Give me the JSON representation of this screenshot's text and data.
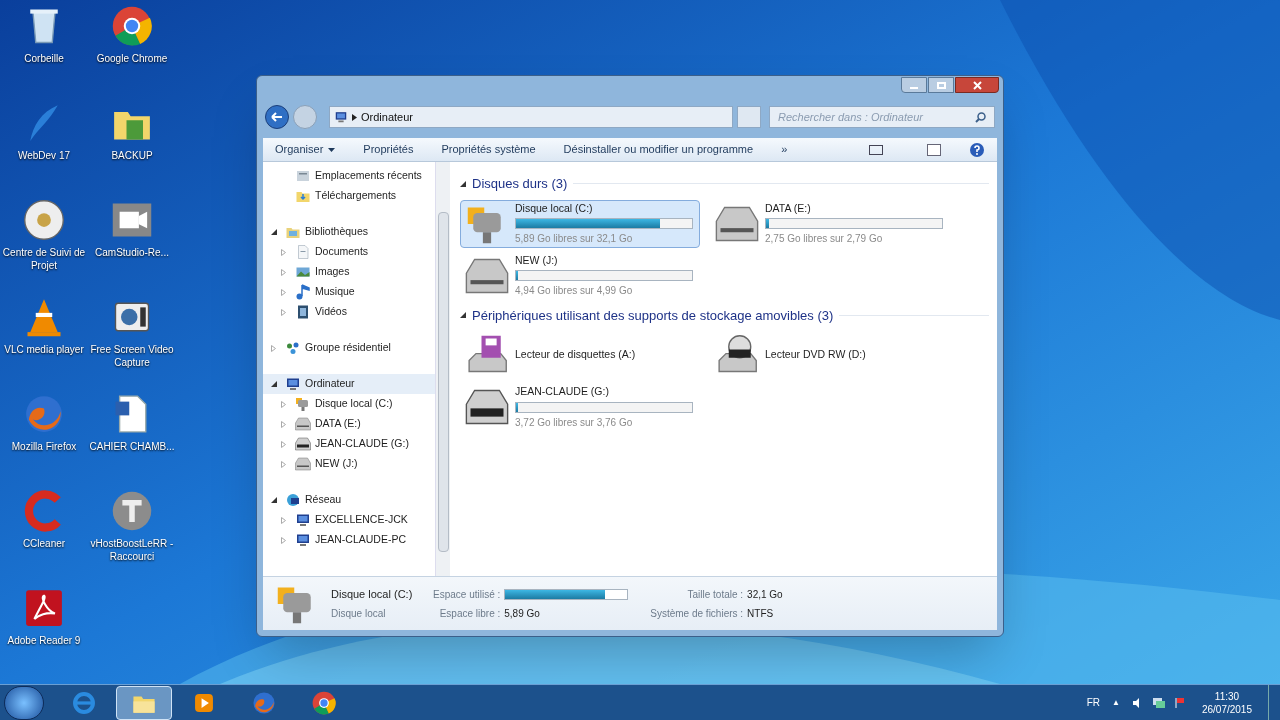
{
  "desktop_icons": [
    {
      "label": "Corbeille",
      "kind": "recycle"
    },
    {
      "label": "Google Chrome",
      "kind": "chrome"
    },
    {
      "label": "WebDev 17",
      "kind": "feather"
    },
    {
      "label": "BACKUP",
      "kind": "folder"
    },
    {
      "label": "Centre de Suivi de Projet",
      "kind": "disc"
    },
    {
      "label": "CamStudio-Re...",
      "kind": "camera"
    },
    {
      "label": "VLC media player",
      "kind": "cone"
    },
    {
      "label": "Free Screen Video Capture",
      "kind": "photo"
    },
    {
      "label": "Mozilla Firefox",
      "kind": "firefox"
    },
    {
      "label": "CAHIER CHAMB...",
      "kind": "document"
    },
    {
      "label": "CCleaner",
      "kind": "cleaner"
    },
    {
      "label": "vHostBoostLeRR - Raccourci",
      "kind": "letter"
    },
    {
      "label": "Adobe Reader 9",
      "kind": "pdf"
    }
  ],
  "window": {
    "address": {
      "crumb": "Ordinateur"
    },
    "search": {
      "placeholder": "Rechercher dans : Ordinateur"
    },
    "toolbar": [
      {
        "label": "Organiser",
        "kind": "menu"
      },
      {
        "label": "Propriétés",
        "kind": "plain"
      },
      {
        "label": "Propriétés système",
        "kind": "plain"
      },
      {
        "label": "Désinstaller ou modifier un programme",
        "kind": "plain"
      },
      {
        "label": "»",
        "kind": "plain"
      }
    ],
    "nav_tree": [
      {
        "label": "Emplacements récents",
        "kind": "recent",
        "expandable": false,
        "selected": false
      },
      {
        "label": "Téléchargements",
        "kind": "download",
        "expandable": false,
        "selected": false
      },
      {
        "label": "Bibliothèques",
        "kind": "library",
        "expandable": true,
        "expanded": true,
        "selected": false,
        "children": [
          {
            "label": "Documents",
            "kind": "docs",
            "expandable": true,
            "expanded": false,
            "selected": false
          },
          {
            "label": "Images",
            "kind": "images",
            "expandable": true,
            "expanded": false,
            "selected": false
          },
          {
            "label": "Musique",
            "kind": "music",
            "expandable": true,
            "expanded": false,
            "selected": false
          },
          {
            "label": "Vidéos",
            "kind": "video",
            "expandable": true,
            "expanded": false,
            "selected": false
          }
        ]
      },
      {
        "label": "Groupe résidentiel",
        "kind": "homegroup",
        "expandable": true,
        "expanded": false,
        "selected": false
      },
      {
        "label": "Ordinateur",
        "kind": "computer",
        "expandable": true,
        "expanded": true,
        "selected": true,
        "children": [
          {
            "label": "Disque local (C:)",
            "kind": "sysdrive",
            "expandable": true,
            "expanded": false,
            "selected": false
          },
          {
            "label": "DATA (E:)",
            "kind": "drive",
            "expandable": true,
            "expanded": false,
            "selected": false
          },
          {
            "label": "JEAN-CLAUDE (G:)",
            "kind": "usb",
            "expandable": true,
            "expanded": false,
            "selected": false
          },
          {
            "label": "NEW (J:)",
            "kind": "drive",
            "expandable": true,
            "expanded": false,
            "selected": false
          }
        ]
      },
      {
        "label": "Réseau",
        "kind": "network",
        "expandable": true,
        "expanded": true,
        "selected": false,
        "children": [
          {
            "label": "EXCELLENCE-JCK",
            "kind": "computer",
            "expandable": true,
            "expanded": false,
            "selected": false
          },
          {
            "label": "JEAN-CLAUDE-PC",
            "kind": "computer",
            "expandable": true,
            "expanded": false,
            "selected": false
          }
        ]
      }
    ],
    "groups": [
      {
        "title": "Disques durs (3)",
        "drives": [
          {
            "name": "Disque local (C:)",
            "kind": "sysdrive",
            "level": 0.82,
            "free": "5,89 Go libres sur 32,1 Go",
            "selected": true
          },
          {
            "name": "DATA (E:)",
            "kind": "drive",
            "level": 0.015,
            "free": "2,75 Go libres sur 2,79 Go",
            "selected": false
          },
          {
            "name": "NEW (J:)",
            "kind": "drive",
            "level": 0.01,
            "free": "4,94 Go libres sur 4,99 Go",
            "selected": false
          }
        ]
      },
      {
        "title": "Périphériques utilisant des supports de stockage amovibles (3)",
        "drives": [
          {
            "name": "Lecteur de disquettes (A:)",
            "kind": "floppy",
            "selected": false
          },
          {
            "name": "Lecteur DVD RW (D:)",
            "kind": "dvd",
            "selected": false
          },
          {
            "name": "JEAN-CLAUDE (G:)",
            "kind": "usb",
            "level": 0.01,
            "free": "3,72 Go libres sur 3,76 Go",
            "selected": false
          }
        ]
      }
    ],
    "details": {
      "name": "Disque local (C:)",
      "type": "Disque local",
      "used_label": "Espace utilisé :",
      "level": 0.82,
      "free_label": "Espace libre :",
      "free": "5,89 Go",
      "size_label": "Taille totale :",
      "size": "32,1 Go",
      "fs_label": "Système de fichiers :",
      "fs": "NTFS"
    }
  },
  "taskbar": {
    "items": [
      {
        "kind": "ie",
        "selected": false
      },
      {
        "kind": "explorer",
        "selected": true
      },
      {
        "kind": "media",
        "selected": false
      },
      {
        "kind": "firefox",
        "selected": false
      },
      {
        "kind": "chrome",
        "selected": false
      }
    ],
    "language": "FR",
    "tray_arrow": "▲",
    "time": "11:30",
    "date": "26/07/2015"
  }
}
